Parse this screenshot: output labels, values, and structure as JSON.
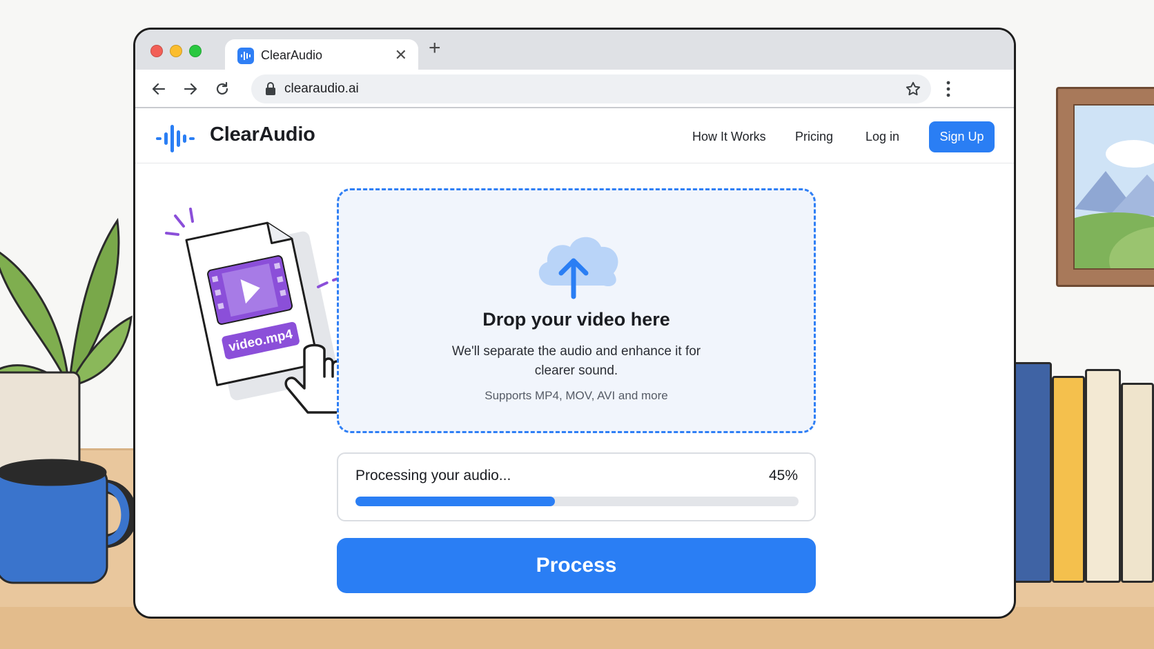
{
  "browser": {
    "tab_title": "ClearAudio",
    "url": "clearaudio.ai"
  },
  "site": {
    "logo_text": "ClearAudio",
    "nav": {
      "how_it_works": "How It Works",
      "pricing": "Pricing",
      "log_in": "Log in",
      "sign_up": "Sign Up"
    }
  },
  "illustration": {
    "file_label": "video.mp4"
  },
  "dropzone": {
    "title": "Drop your video here",
    "description": "We'll separate the audio and enhance it for clearer sound.",
    "formats": "Supports MP4, MOV, AVI and more"
  },
  "progress": {
    "label": "Processing your audio...",
    "percent_text": "45%",
    "value": 0.45
  },
  "actions": {
    "process": "Process"
  },
  "colors": {
    "accent": "#2a7ef4",
    "file_purple": "#8b4fd9",
    "dropzone_bg": "#f1f5fc"
  }
}
